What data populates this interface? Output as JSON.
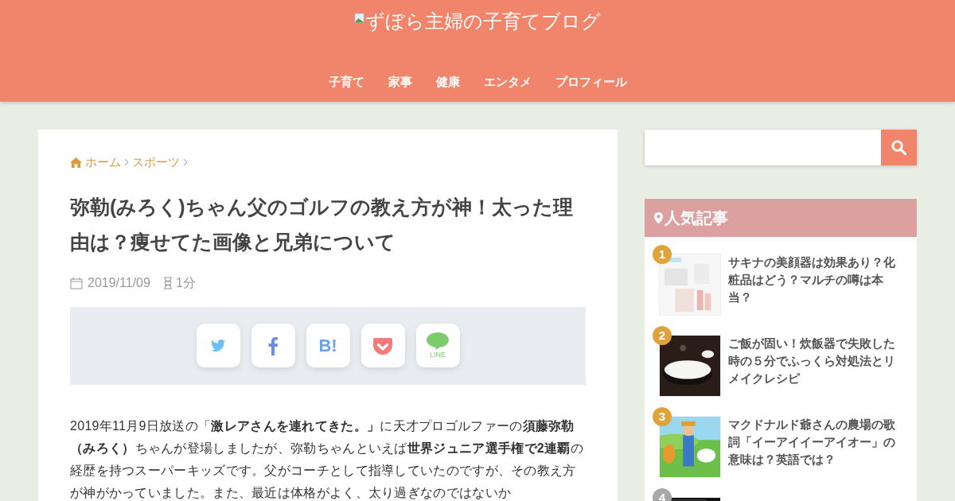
{
  "header": {
    "site_title": "ずぼら主婦の子育てブログ",
    "nav": [
      "子育て",
      "家事",
      "健康",
      "エンタメ",
      "プロフィール"
    ]
  },
  "breadcrumb": [
    "ホーム",
    "スポーツ"
  ],
  "article": {
    "title": "弥勒(みろく)ちゃん父のゴルフの教え方が神！太った理由は？痩せてた画像と兄弟について",
    "date": "2019/11/09",
    "read_time": "1分",
    "share": [
      {
        "kind": "twitter"
      },
      {
        "kind": "facebook"
      },
      {
        "kind": "hatena",
        "label": "B!"
      },
      {
        "kind": "pocket"
      },
      {
        "kind": "line",
        "label": "LINE"
      }
    ],
    "body": "2019年11月9日放送の「**激レアさんを連れてきた。」**に天才プロゴルファーの**須藤弥勒（みろく）**ちゃんが登場しましたが、弥勒ちゃんといえば**世界ジュニア選手権で2連覇**の経歴を持つスーパーキッズです。父がコーチとして指導していたのですが、その教え方が神がかっていました。また、最近は体格がよく、太り過ぎなのではないか"
  },
  "sidebar": {
    "popular": {
      "title": "人気記事",
      "items": [
        {
          "rank": "1",
          "color": "#e0a23a",
          "title": "サキナの美顔器は効果あり？化粧品はどう？マルチの噂は本当？",
          "kind": "cosmetics"
        },
        {
          "rank": "2",
          "color": "#e0a23a",
          "title": "ご飯が固い！炊飯器で失敗した時の５分でふっくら対処法とリメイクレシピ",
          "kind": "rice"
        },
        {
          "rank": "3",
          "color": "#e0a23a",
          "title": "マクドナルド爺さんの農場の歌詞「イーアイイーアイオー」の意味は？英語では？",
          "kind": "farm"
        },
        {
          "rank": "4",
          "color": "#a8a8a8",
          "kind": "dark"
        }
      ]
    }
  }
}
